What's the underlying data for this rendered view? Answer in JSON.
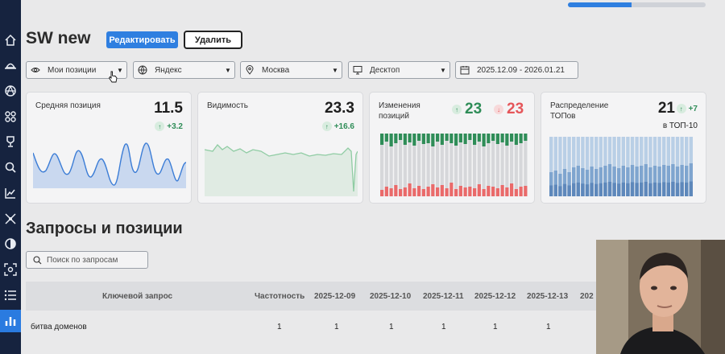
{
  "progress": {
    "value": 0.46
  },
  "sidebar": {
    "icons": [
      "home-icon",
      "hat-icon",
      "triangles-icon",
      "apps-icon",
      "trophy-icon",
      "search-icon",
      "trend-icon",
      "network-icon",
      "target-icon",
      "eye-scan-icon",
      "list-icon",
      "bar-chart-icon"
    ]
  },
  "header": {
    "title": "SW new",
    "edit_label": "Редактировать",
    "delete_label": "Удалить"
  },
  "filters": {
    "positions": "Мои позиции",
    "engine": "Яндекс",
    "region": "Москва",
    "device": "Десктоп",
    "dates": "2025.12.09 - 2026.01.21"
  },
  "cards": {
    "avg": {
      "label": "Средняя позиция",
      "value": "11.5",
      "delta": "+3.2"
    },
    "visibility": {
      "label": "Видимость",
      "value": "23.3",
      "delta": "+16.6"
    },
    "changes": {
      "label_line1": "Изменения",
      "label_line2": "позиций",
      "up": "23",
      "down": "23"
    },
    "distribution": {
      "label_line1": "Распределение",
      "label_line2": "ТОПов",
      "value": "21",
      "delta": "+7",
      "caption": "в ТОП-10"
    }
  },
  "section": {
    "title": "Запросы и позиции",
    "search_placeholder": "Поиск по запросам"
  },
  "table": {
    "headers": [
      "Ключевой запрос",
      "Частотность",
      "2025-12-09",
      "2025-12-10",
      "2025-12-11",
      "2025-12-12",
      "2025-12-13",
      "202"
    ],
    "rows": [
      {
        "query": "битва доменов",
        "freq": "1",
        "d1": "1",
        "d2": "1",
        "d3": "1",
        "d4": "1",
        "d5": "1"
      }
    ]
  },
  "colors": {
    "accent": "#2f7fe0",
    "sidebar": "#16233f",
    "positive": "#2f8d58",
    "negative": "#e5565a"
  }
}
